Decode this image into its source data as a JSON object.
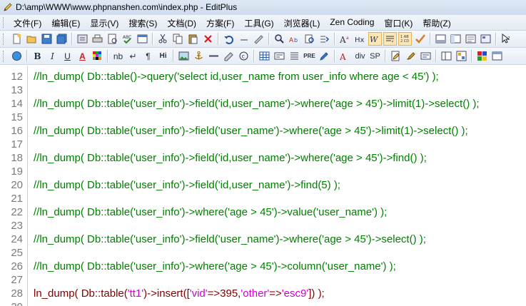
{
  "window": {
    "title": "D:\\amp\\WWW\\www.phpnanshen.com\\index.php - EditPlus"
  },
  "menu": {
    "items": [
      {
        "label": "文件(F)"
      },
      {
        "label": "编辑(E)"
      },
      {
        "label": "显示(V)"
      },
      {
        "label": "搜索(S)"
      },
      {
        "label": "文档(D)"
      },
      {
        "label": "方案(F)"
      },
      {
        "label": "工具(G)"
      },
      {
        "label": "浏览器(L)"
      },
      {
        "label": "Zen Coding"
      },
      {
        "label": "窗口(K)"
      },
      {
        "label": "帮助(Z)"
      }
    ]
  },
  "toolbar2_text": {
    "bold": "B",
    "italic": "I",
    "underline": "U",
    "font_color": "A",
    "nbsp": "nb",
    "line_break": "↵",
    "paragraph": "¶",
    "heading": "Hi",
    "pre": "PRE",
    "div": "div",
    "span": "SP"
  },
  "editor": {
    "lines": [
      {
        "no": "12",
        "parts": [
          {
            "t": "c",
            "text": "//ln_dump( Db::table()->query('select id,user_name from user_info where age < 45') );"
          }
        ]
      },
      {
        "no": "13",
        "parts": []
      },
      {
        "no": "14",
        "parts": [
          {
            "t": "c",
            "text": "//ln_dump( Db::table('user_info')->field('id,user_name')->where('age > 45')->limit(1)->select() );"
          }
        ]
      },
      {
        "no": "15",
        "parts": []
      },
      {
        "no": "16",
        "parts": [
          {
            "t": "c",
            "text": "//ln_dump( Db::table('user_info')->field('user_name')->where('age > 45')->limit(1)->select() );"
          }
        ]
      },
      {
        "no": "17",
        "parts": []
      },
      {
        "no": "18",
        "parts": [
          {
            "t": "c",
            "text": "//ln_dump( Db::table('user_info')->field('id,user_name')->where('age > 45')->find() );"
          }
        ]
      },
      {
        "no": "19",
        "parts": []
      },
      {
        "no": "20",
        "parts": [
          {
            "t": "c",
            "text": "//ln_dump( Db::table('user_info')->field('id,user_name')->find(5) );"
          }
        ]
      },
      {
        "no": "21",
        "parts": []
      },
      {
        "no": "22",
        "parts": [
          {
            "t": "c",
            "text": "//ln_dump( Db::table('user_info')->where('age > 45')->value('user_name') );"
          }
        ]
      },
      {
        "no": "23",
        "parts": []
      },
      {
        "no": "24",
        "parts": [
          {
            "t": "c",
            "text": "//ln_dump( Db::table('user_info')->field('user_name')->where('age > 45')->select() );"
          }
        ]
      },
      {
        "no": "25",
        "parts": []
      },
      {
        "no": "26",
        "parts": [
          {
            "t": "c",
            "text": "//ln_dump( Db::table('user_info')->where('age > 45')->column('user_name') );"
          }
        ]
      },
      {
        "no": "27",
        "parts": []
      },
      {
        "no": "28",
        "parts": [
          {
            "t": "p",
            "text": "ln_dump( Db::table("
          },
          {
            "t": "s",
            "text": "'tt1'"
          },
          {
            "t": "p",
            "text": ")->insert(["
          },
          {
            "t": "s",
            "text": "'vid'"
          },
          {
            "t": "p",
            "text": "=>395,"
          },
          {
            "t": "s",
            "text": "'other'"
          },
          {
            "t": "p",
            "text": "=>"
          },
          {
            "t": "s",
            "text": "'esc9'"
          },
          {
            "t": "p",
            "text": "]) );"
          }
        ]
      },
      {
        "no": "29",
        "parts": []
      }
    ]
  },
  "colors": {
    "comment": "#008000",
    "code": "#800000",
    "string": "#d000d0"
  }
}
